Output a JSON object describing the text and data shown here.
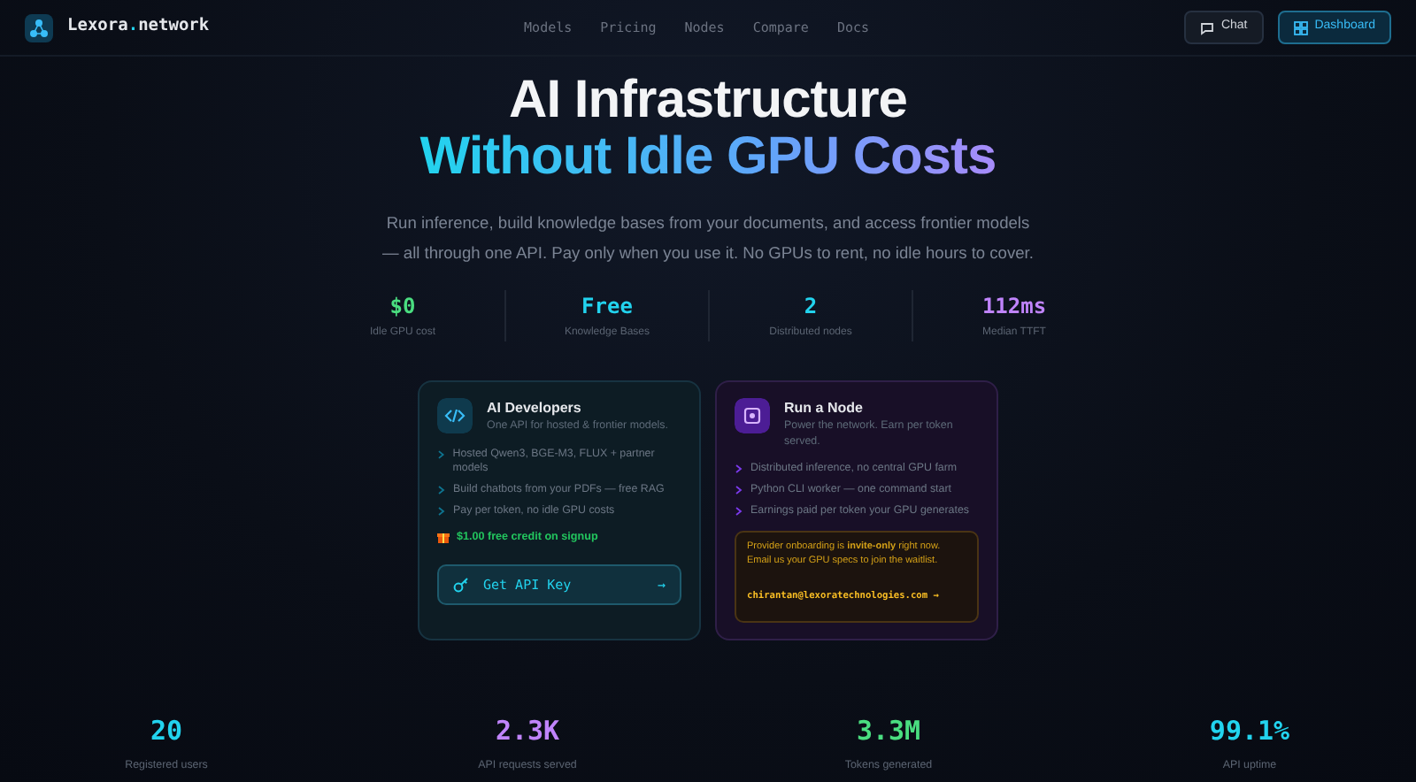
{
  "navbar": {
    "brand_prefix": "Lexora",
    "brand_dot": ".",
    "brand_suffix": "network",
    "links": [
      "Models",
      "Pricing",
      "Nodes",
      "Compare",
      "Docs"
    ],
    "chat_button": "Chat",
    "dashboard_button": "Dashboard"
  },
  "hero": {
    "title_line_1": "AI Infrastructure",
    "title_line_2": "Without Idle GPU Costs",
    "subtitle": "Run inference, build knowledge bases from your documents, and access frontier models — all through one API. Pay only when you use it. No GPUs to rent, no idle hours to cover."
  },
  "hero_stats": [
    {
      "value": "$0",
      "label": "Idle GPU cost",
      "color": "#4ade80"
    },
    {
      "value": "Free",
      "label": "Knowledge Bases",
      "color": "#22d3ee"
    },
    {
      "value": "2",
      "label": "Distributed nodes",
      "color": "#22d3ee"
    },
    {
      "value": "112ms",
      "label": "Median TTFT",
      "color": "#c084fc"
    }
  ],
  "cards": [
    {
      "kind": "developer",
      "title": "AI Developers",
      "subtitle": "One API for hosted & frontier models.",
      "bullets": [
        "Hosted Qwen3, BGE-M3, FLUX + partner models",
        "Build chatbots from your PDFs — free RAG",
        "Pay per token, no idle GPU costs"
      ],
      "credit": "$1.00 free credit on signup",
      "button": "Get API Key",
      "button_arrow": "→"
    },
    {
      "kind": "node",
      "title": "Run a Node",
      "subtitle": "Power the network. Earn per token served.",
      "bullets": [
        "Distributed inference, no central GPU farm",
        "Python CLI worker — one command start",
        "Earnings paid per token your GPU generates"
      ],
      "notice": "Provider onboarding is **invite-only** right now. Email us your GPU specs to join the waitlist.",
      "email": "chirantan@lexoratechnologies.com →"
    }
  ],
  "metrics": [
    {
      "value": "20",
      "label": "Registered users",
      "color": "#22d3ee"
    },
    {
      "value": "2.3K",
      "label": "API requests served",
      "color": "#c084fc"
    },
    {
      "value": "3.3M",
      "label": "Tokens generated",
      "color": "#4ade80"
    },
    {
      "value": "99.1%",
      "label": "API uptime",
      "color": "#22d3ee"
    }
  ]
}
